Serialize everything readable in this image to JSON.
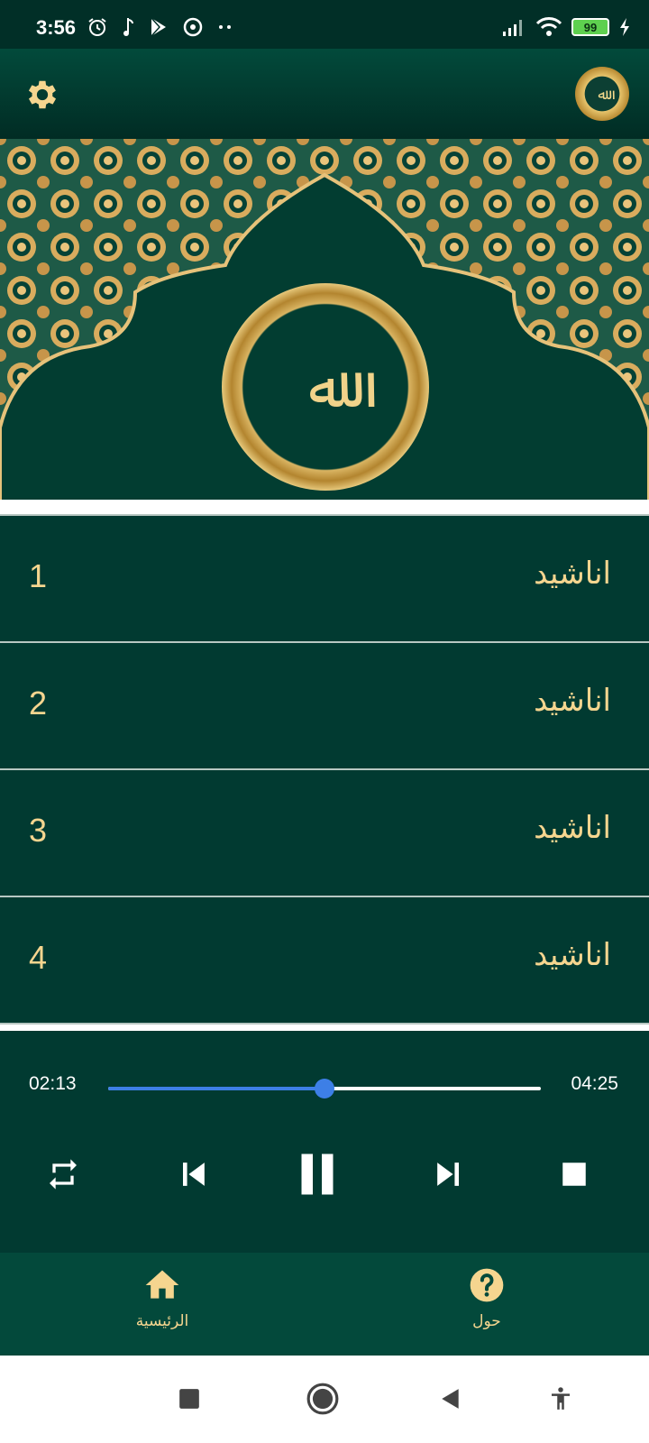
{
  "status_bar": {
    "time": "3:56",
    "battery": "99",
    "icons_left": [
      "alarm-icon",
      "music-note-icon",
      "play-store-icon",
      "vpn-icon",
      "more-dots-icon"
    ],
    "icons_right": [
      "signal-icon",
      "wifi-icon",
      "battery-icon",
      "charging-icon"
    ]
  },
  "toolbar": {
    "settings_icon": "gear-icon",
    "logo": "allah-calligraphy-logo"
  },
  "banner": {
    "image": "islamic-arch-pattern-with-allah-calligraphy"
  },
  "list": {
    "items": [
      {
        "title": "اناشيد",
        "number": "1"
      },
      {
        "title": "اناشيد",
        "number": "2"
      },
      {
        "title": "اناشيد",
        "number": "3"
      },
      {
        "title": "اناشيد",
        "number": "4"
      }
    ]
  },
  "player": {
    "current_time": "02:13",
    "total_time": "04:25",
    "progress": 0.501,
    "controls": [
      "repeat-icon",
      "previous-icon",
      "pause-icon",
      "next-icon",
      "stop-icon"
    ]
  },
  "bottom_nav": {
    "home_label": "الرئيسية",
    "about_label": "حول"
  },
  "colors": {
    "background": "#013a31",
    "gold": "#f5d58f",
    "accent": "#3d7fe6"
  }
}
